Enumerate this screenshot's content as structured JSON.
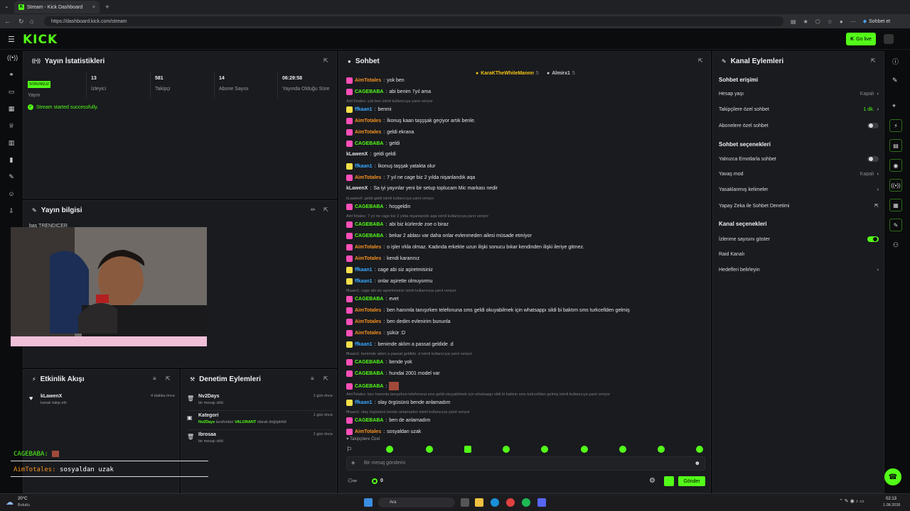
{
  "browser": {
    "tab_title": "Stream - Kick Dashboard",
    "url": "https://dashboard.kick.com/stream",
    "profile_button": "Sohbet et"
  },
  "header": {
    "logo": "KICK",
    "go_live": "Go live"
  },
  "stats": {
    "title": "Yayın İstatistikleri",
    "items": [
      {
        "value": "SORUNSUZ",
        "label": "Yayın"
      },
      {
        "value": "13",
        "label": "İzleyici"
      },
      {
        "value": "581",
        "label": "Takipçi"
      },
      {
        "value": "14",
        "label": "Abone Sayısı"
      },
      {
        "value": "06:29:58",
        "label": "Yayında Olduğu Süre"
      }
    ],
    "success_msg": "Stream started successfully."
  },
  "info": {
    "title": "Yayın bilgisi",
    "partial": "bas TRENDICER"
  },
  "activity": {
    "title": "Etkinlik Akışı",
    "items": [
      {
        "name": "kLawenX",
        "desc": "kanalı takip etti",
        "time": "4 dakika önce"
      }
    ]
  },
  "moderation": {
    "title": "Denetim Eylemleri",
    "items": [
      {
        "name": "Nv2Days",
        "desc": "bir mesajı sildi",
        "time": "1 gün önce"
      },
      {
        "name": "Kategori",
        "desc_user": "Nv2Days",
        "desc_mid": "tarafından",
        "desc_cat": "VALORANT",
        "desc_end": "olarak değiştirildi",
        "time": "1 gün önce"
      },
      {
        "name": "Ibrosaa",
        "desc": "bir mesajı sildi",
        "time": "1 gün önce"
      }
    ]
  },
  "overlay": {
    "line1_user": "CAGEBABA:",
    "line2_user": "AimTotales:",
    "line2_text": "sosyaldan uzak"
  },
  "chat": {
    "title": "Sohbet",
    "pinned": [
      {
        "name": "KaraKTheWhiteMannn",
        "count": "5"
      },
      {
        "name": "Almirx1",
        "count": "5"
      }
    ],
    "lines": [
      {
        "type": "msg",
        "user": "AimTotales",
        "text": "yok ben",
        "cls": "a"
      },
      {
        "type": "msg",
        "user": "CAGEBABA",
        "text": "abi benim 7yıl ama",
        "cls": "c"
      },
      {
        "type": "reply",
        "text": "AimTotales: yok ben isimli kullanıcıya yanıt veriyor"
      },
      {
        "type": "msg",
        "user": "ffkaan1",
        "text": "benmi",
        "cls": "f"
      },
      {
        "type": "msg",
        "user": "AimTotales",
        "text": "İkonuş kaan taşşşak geçiyor artık benle.",
        "cls": "a"
      },
      {
        "type": "msg",
        "user": "AimTotales",
        "text": "geldi ekrana",
        "cls": "a"
      },
      {
        "type": "msg",
        "user": "CAGEBABA",
        "text": "geldi",
        "cls": "c"
      },
      {
        "type": "msg",
        "user": "kLawenX",
        "text": "geldi geldi",
        "cls": "k"
      },
      {
        "type": "msg",
        "user": "ffkaan1",
        "text": "İkonuş taşşak yatakta olur",
        "cls": "f"
      },
      {
        "type": "msg",
        "user": "AimTotales",
        "text": "7 yıl ne cage biz 2 yılda nişanlandık aqa",
        "cls": "a"
      },
      {
        "type": "msg",
        "user": "kLawenX",
        "text": "Sa iyi yayınlar yeni bir setup toplucam Mic markası nedir",
        "cls": "k"
      },
      {
        "type": "reply",
        "text": "kLawenX: geldi geldi isimli kullanıcıya yanıt veriyor"
      },
      {
        "type": "msg",
        "user": "CAGEBABA",
        "text": "hoşgeldin",
        "cls": "c"
      },
      {
        "type": "reply",
        "text": "AimTotales: 7 yıl ne cage biz 2 yılda nişanlandık aqa isimli kullanıcıya yanıt veriyor"
      },
      {
        "type": "msg",
        "user": "CAGEBABA",
        "text": "abi biz kürlerde zoe o biraz",
        "cls": "c"
      },
      {
        "type": "msg",
        "user": "CAGEBABA",
        "text": "bekar 2 ablası var daha onlar evlenmeden ailesi müsade etmiyor",
        "cls": "c"
      },
      {
        "type": "msg",
        "user": "AimTotales",
        "text": "o işler ırkla olmaz. Kadında erkekte uzun ilişki sonucu bıkar kendinden ilişki ileriye gitmez.",
        "cls": "a"
      },
      {
        "type": "msg",
        "user": "AimTotales",
        "text": "kendi kararınız",
        "cls": "a"
      },
      {
        "type": "msg",
        "user": "ffkaan1",
        "text": "cage abi siz aşiretmisiniz",
        "cls": "f"
      },
      {
        "type": "msg",
        "user": "ffkaan1",
        "text": "onlar aşirette olmuyormu",
        "cls": "f"
      },
      {
        "type": "reply",
        "text": "ffkaan1: cage abi siz aşiretmisiniz isimli kullanıcıya yanıt veriyor"
      },
      {
        "type": "msg",
        "user": "CAGEBABA",
        "text": "evet",
        "cls": "c"
      },
      {
        "type": "msg",
        "user": "AimTotales",
        "text": "ben hanımla tanışırken telefonuna sms geldi okuyabilmek için whatsappı sildi bi baktım sms turkcellden gelmiş",
        "cls": "a"
      },
      {
        "type": "msg",
        "user": "AimTotales",
        "text": "ben dedim evlenirim bununla",
        "cls": "a"
      },
      {
        "type": "msg",
        "user": "AimTotales",
        "text": "şükür :D",
        "cls": "a"
      },
      {
        "type": "msg",
        "user": "ffkaan1",
        "text": "benimde aklım a passat geldide .d",
        "cls": "f"
      },
      {
        "type": "reply",
        "text": "ffkaan1: benimde aklım a passat geldide .d isimli kullanıcıya yanıt veriyor"
      },
      {
        "type": "msg",
        "user": "CAGEBABA",
        "text": "bende yok",
        "cls": "c"
      },
      {
        "type": "msg",
        "user": "CAGEBABA",
        "text": "hundai 2001 model var",
        "cls": "c"
      },
      {
        "type": "msg",
        "user": "CAGEBABA",
        "text": "",
        "cls": "c",
        "emote": true
      },
      {
        "type": "reply",
        "text": "AimTotales: ben hanımla tanışırken telefonuna sms geldi okuyabilmek için whatsappı sildi bi baktım sms turkcellden gelmiş isimli kullanıcıya yanıt veriyor"
      },
      {
        "type": "msg",
        "user": "ffkaan1",
        "text": "olay örgüsünü bende anlamadım",
        "cls": "f"
      },
      {
        "type": "reply",
        "text": "ffkaan1: olay örgüsünü bende anlamadım isimli kullanıcıya yanıt veriyor"
      },
      {
        "type": "msg",
        "user": "CAGEBABA",
        "text": "ben de anlamadım",
        "cls": "c"
      },
      {
        "type": "msg",
        "user": "AimTotales",
        "text": "sosyaldan uzak",
        "cls": "a"
      }
    ],
    "followers_only": "Takipçilere Özel",
    "input_placeholder": "Bir mesaj gönderin",
    "count": "0",
    "send": "Gönder"
  },
  "channel": {
    "title": "Kanal Eylemleri",
    "sec1": "Sohbet erişimi",
    "account_age": "Hesap yaşı",
    "account_age_val": "Kapalı",
    "followers_chat": "Takipçilere özel sohbet",
    "followers_chat_val": "1 dk.",
    "subs_chat": "Abonelere özel sohbet",
    "sec2": "Sohbet seçenekleri",
    "emotes_only": "Yalnızca Emotlarla sohbet",
    "slow_mode": "Yavaş mod",
    "slow_mode_val": "Kapalı",
    "banned_words": "Yasaklanmış kelimeler",
    "ai_mod": "Yapay Zeka ile Sohbet Denetimi",
    "sec3": "Kanal seçenekleri",
    "show_viewers": "İzlenme sayısını göster",
    "raid": "Raid Kanalı",
    "goals": "Hedefleri belirleyin"
  },
  "taskbar": {
    "weather_temp": "20°C",
    "weather_desc": "Bulutlu",
    "search": "Ara",
    "time": "02:13",
    "date": "1.08.2026"
  },
  "colors": {
    "accent": "#53fc18",
    "panel": "#191b1f",
    "bg": "#0b0c0d"
  }
}
